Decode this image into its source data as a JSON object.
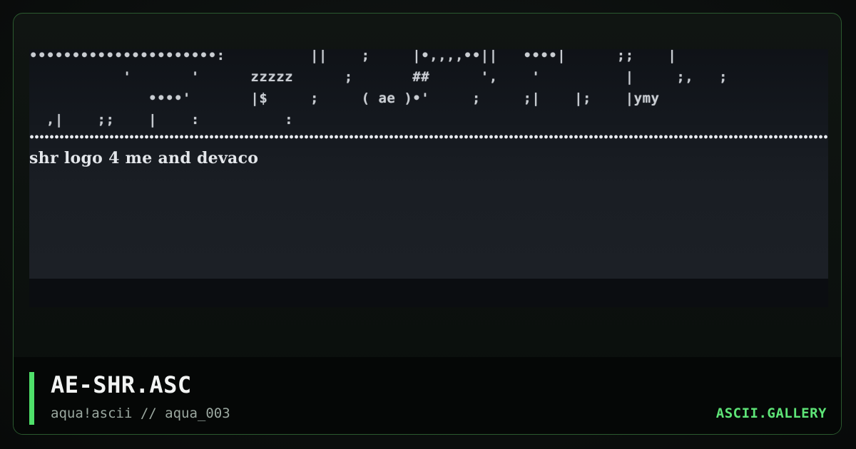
{
  "artwork": {
    "ascii_lines": [
      "••••••••••••••••••••••:          ||    ;     |•,,,,••||   ••••|      ;;    |",
      "           '       '      zzzzz      ;       ##      ',    '          |     ;,   ;",
      "              ••••'       |$     ;     ( ae )•'     ;     ;|    |;    |ymy",
      "  ,|    ;;    |    :          :"
    ],
    "caption": "shr logo 4 me and devaco"
  },
  "footer": {
    "title": "AE-SHR.ASC",
    "subtitle": "aqua!ascii // aqua_003",
    "brand": "ASCII.GALLERY"
  },
  "colors": {
    "accent": "#4fe06a",
    "brand": "#5ee477",
    "frame_border": "#2b5a2f"
  }
}
